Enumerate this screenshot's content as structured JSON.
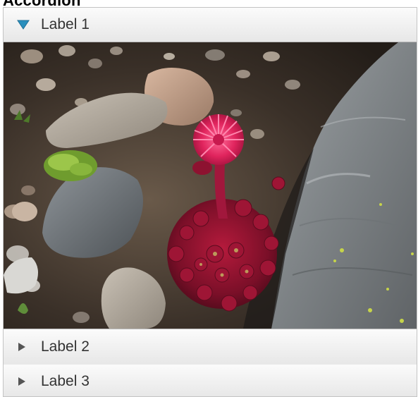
{
  "page_title": "Accordion",
  "accordion": {
    "panes": [
      {
        "label": "Label 1",
        "expanded": true,
        "arrow_icon": "triangle-down-icon",
        "arrow_color": "#2a8fbd"
      },
      {
        "label": "Label 2",
        "expanded": false,
        "arrow_icon": "triangle-right-icon",
        "arrow_color": "#555555"
      },
      {
        "label": "Label 3",
        "expanded": false,
        "arrow_icon": "triangle-right-icon",
        "arrow_color": "#555555"
      }
    ],
    "content_image": "photo-flower-among-rocks"
  }
}
